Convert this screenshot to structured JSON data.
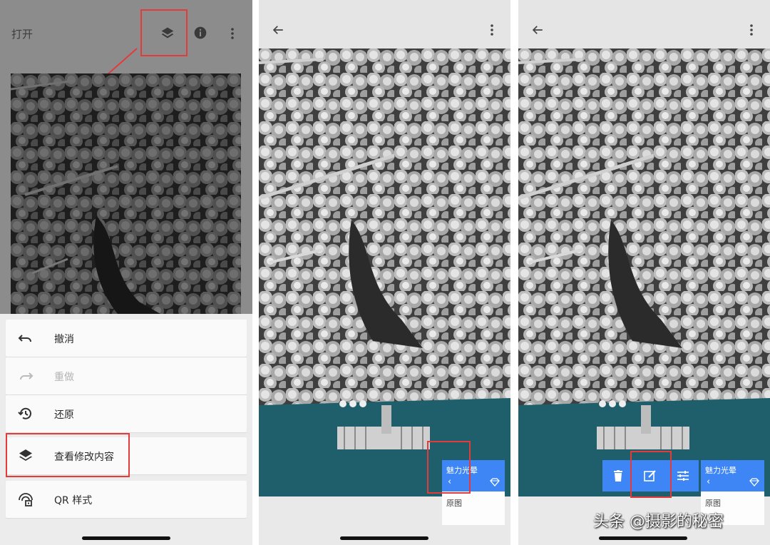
{
  "panel1": {
    "title": "打开",
    "menu": [
      {
        "label": "撤消",
        "icon": "undo-icon",
        "enabled": true
      },
      {
        "label": "重做",
        "icon": "redo-icon",
        "enabled": false
      },
      {
        "label": "还原",
        "icon": "history-icon",
        "enabled": true
      },
      {
        "label": "查看修改内容",
        "icon": "layers-icon",
        "enabled": true
      },
      {
        "label": "QR 样式",
        "icon": "qr-style-icon",
        "enabled": true
      }
    ]
  },
  "panel2": {
    "stack_name": "魅力光晕",
    "original_label": "原图"
  },
  "panel3": {
    "stack_name": "魅力光晕",
    "original_label": "原图"
  },
  "watermark": "头条 @摄影的秘密",
  "colors": {
    "accent_blue": "#3e86f5",
    "highlight_red": "#e23b3b",
    "water_teal": "#1f5f6b"
  }
}
